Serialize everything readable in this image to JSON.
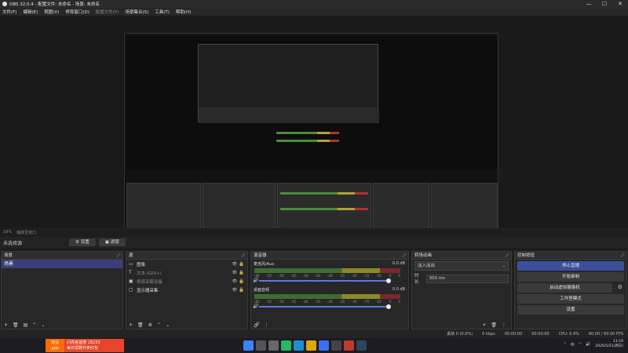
{
  "window": {
    "title": "OBS 32.0.4 - 配置文件: 未命名 - 场景: 未命名",
    "minimize": "—",
    "maximize": "☐",
    "close": "✕"
  },
  "menu": [
    "文件(F)",
    "编辑(E)",
    "视图(V)",
    "停靠窗口(D)",
    "配置文件(P)",
    "场景集合(S)",
    "工具(T)",
    "帮助(H)"
  ],
  "zoom": {
    "scale": "19%",
    "mode": "缩放至窗口"
  },
  "source_bar": {
    "no_source": "未选择源",
    "settings": "设置",
    "filters": "滤镜"
  },
  "scenes": {
    "title": "场景",
    "items": [
      "场景"
    ]
  },
  "sources": {
    "title": "源",
    "items": [
      {
        "icon": "image-icon",
        "label": "图像",
        "dim": false
      },
      {
        "icon": "text-icon",
        "label": "文本 (GDI+)",
        "dim": true
      },
      {
        "icon": "video-capture-icon",
        "label": "视频采集设备",
        "dim": true
      },
      {
        "icon": "display-capture-icon",
        "label": "显示器采集",
        "dim": false
      }
    ]
  },
  "mixer": {
    "title": "混音器",
    "channels": [
      {
        "name": "麦克风/Aux",
        "db": "0.0 dB"
      },
      {
        "name": "桌面音频",
        "db": "0.0 dB"
      }
    ],
    "scale": [
      "-60",
      "-55",
      "-50",
      "-45",
      "-40",
      "-35",
      "-30",
      "-25",
      "-20",
      "-15",
      "-10",
      "-5",
      "0"
    ]
  },
  "transitions": {
    "title": "转场动画",
    "selected": "淡入淡出",
    "duration_label": "时长",
    "duration_value": "300 ms"
  },
  "controls": {
    "title": "控制按钮",
    "buttons": [
      "停止直播",
      "开始录制",
      "启动虚拟摄像机",
      "工作室模式",
      "设置"
    ]
  },
  "status": {
    "dropped": "丢帧 0 (0.0%)",
    "bitrate": "0 kbps",
    "live_time": "00:00:00",
    "rec_time": "00:00:00",
    "cpu": "CPU: 0.4%",
    "fps": "60.00 / 60.00 FPS"
  },
  "taskbar": {
    "ad_brand_line1": "淘宝",
    "ad_brand_line2": "APP",
    "ad_line1": "闪亮官迪搜 18233",
    "ad_line2": "每日领数外卖红包",
    "ime": "中",
    "time": "11:19",
    "date": "2026/5/21(周日)"
  },
  "colors": {
    "accent": "#3b4f9e",
    "scene_selected": "#3a3f7a",
    "fader": "#5a7ce0",
    "ad": "#e8442b"
  }
}
